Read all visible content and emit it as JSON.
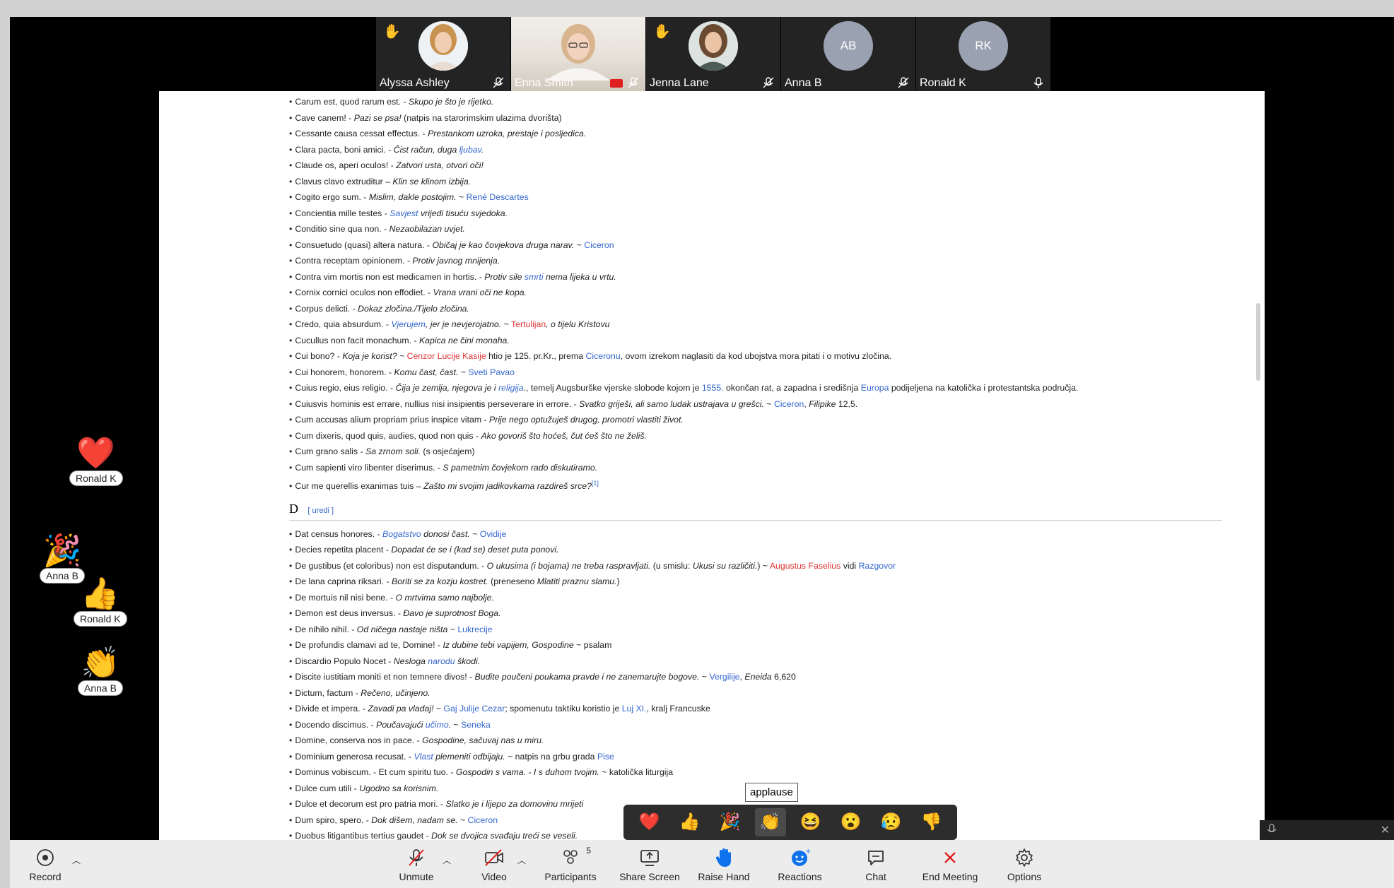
{
  "participants": [
    {
      "name": "Alyssa Ashley",
      "hand": true,
      "type": "photo",
      "muted": true
    },
    {
      "name": "Enna Smith",
      "hand": false,
      "type": "video",
      "muted": true,
      "camera_off": true
    },
    {
      "name": "Jenna Lane",
      "hand": true,
      "type": "photo",
      "muted": true
    },
    {
      "name": "Anna B",
      "hand": false,
      "type": "initials",
      "initials": "AB",
      "muted": true
    },
    {
      "name": "Ronald K",
      "hand": false,
      "type": "initials",
      "initials": "RK",
      "muted": false
    }
  ],
  "doc_items_c": [
    [
      [
        "Carum est, quod rarum est. - ",
        ""
      ],
      [
        "Skupo je što je rijetko.",
        "it"
      ]
    ],
    [
      [
        "Cave canem! - ",
        ""
      ],
      [
        "Pazi se psa!",
        "it"
      ],
      [
        " (natpis na starorimskim ulazima dvorišta)",
        ""
      ]
    ],
    [
      [
        "Cessante causa cessat effectus. - ",
        ""
      ],
      [
        "Prestankom uzroka, prestaje i posljedica.",
        "it"
      ]
    ],
    [
      [
        "Clara pacta, boni amici. - ",
        ""
      ],
      [
        "Čist račun, duga ",
        "it"
      ],
      [
        "ljubav",
        "it lk"
      ],
      [
        ".",
        "it"
      ]
    ],
    [
      [
        "Claude os, aperi oculos! - ",
        ""
      ],
      [
        "Zatvori usta, otvori oči!",
        "it"
      ]
    ],
    [
      [
        "Clavus clavo extruditur – ",
        ""
      ],
      [
        "Klin se klinom izbija.",
        "it"
      ]
    ],
    [
      [
        "Cogito ergo sum. - ",
        ""
      ],
      [
        "Mislim, dakle postojim.",
        "it"
      ],
      [
        " ~ ",
        ""
      ],
      [
        "René Descartes",
        "lk"
      ]
    ],
    [
      [
        "Concientia mille testes - ",
        ""
      ],
      [
        "Savjest",
        "it lk"
      ],
      [
        " vrijedi tisuću svjedoka.",
        "it"
      ]
    ],
    [
      [
        "Conditio sine qua non. - ",
        ""
      ],
      [
        "Nezaobilazan uvjet.",
        "it"
      ]
    ],
    [
      [
        "Consuetudo (quasi) altera natura. - ",
        ""
      ],
      [
        "Običaj je kao čovjekova druga narav.",
        "it"
      ],
      [
        " ~ ",
        ""
      ],
      [
        "Ciceron",
        "lk"
      ]
    ],
    [
      [
        "Contra receptam opinionem. - ",
        ""
      ],
      [
        "Protiv javnog mnijenja.",
        "it"
      ]
    ],
    [
      [
        "Contra vim mortis non est medicamen in hortis. - ",
        ""
      ],
      [
        "Protiv sile ",
        "it"
      ],
      [
        "smrti",
        "it lk"
      ],
      [
        " nema lijeka u vrtu.",
        "it"
      ]
    ],
    [
      [
        "Cornix cornici oculos non effodiet. - ",
        ""
      ],
      [
        "Vrana vrani oči ne kopa.",
        "it"
      ]
    ],
    [
      [
        "Corpus delicti. - ",
        ""
      ],
      [
        "Dokaz zločina./Tijelo zločina.",
        "it"
      ]
    ],
    [
      [
        "Credo, quia absurdum. - ",
        ""
      ],
      [
        "Vjerujem",
        "it lk"
      ],
      [
        ", jer je nevjerojatno.",
        "it"
      ],
      [
        " ~ ",
        ""
      ],
      [
        "Tertulijan",
        "rd"
      ],
      [
        ", o tijelu Kristovu",
        "it"
      ]
    ],
    [
      [
        "Cucullus non facit monachum. - ",
        ""
      ],
      [
        "Kapica ne čini monaha.",
        "it"
      ]
    ],
    [
      [
        "Cui bono? - ",
        ""
      ],
      [
        "Koja je korist?",
        "it"
      ],
      [
        " ~ ",
        ""
      ],
      [
        "Cenzor Lucije Kasije",
        "rd"
      ],
      [
        " htio je 125. pr.Kr., prema ",
        ""
      ],
      [
        "Ciceronu",
        "lk"
      ],
      [
        ", ovom izrekom naglasiti da kod ubojstva mora pitati i o motivu zločina.",
        ""
      ]
    ],
    [
      [
        "Cui honorem, honorem. - ",
        ""
      ],
      [
        "Komu čast, čast.",
        "it"
      ],
      [
        " ~ ",
        ""
      ],
      [
        "Sveti Pavao",
        "lk"
      ]
    ],
    [
      [
        "Cuius regio, eius religio. - ",
        ""
      ],
      [
        "Čija je zemlja, njegova je i ",
        "it"
      ],
      [
        "religija",
        "it lk"
      ],
      [
        ".",
        ""
      ],
      [
        ", temelj Augsburške vjerske slobode kojom je ",
        ""
      ],
      [
        "1555.",
        "lk"
      ],
      [
        " okončan rat, a zapadna i središnja ",
        ""
      ],
      [
        "Europa",
        "lk"
      ],
      [
        " podijeljena na katolička i protestantska područja.",
        ""
      ]
    ],
    [
      [
        "Cuiusvis hominis est errare, nullius nisi insipientis perseverare in errore. - ",
        ""
      ],
      [
        "Svatko griješi, ali samo ludak ustrajava u grešci.",
        "it"
      ],
      [
        " ~ ",
        ""
      ],
      [
        "Ciceron",
        "lk"
      ],
      [
        ", ",
        ""
      ],
      [
        "Filipike",
        "it"
      ],
      [
        " 12,5.",
        ""
      ]
    ],
    [
      [
        "Cum accusas alium propriam prius inspice vitam - ",
        ""
      ],
      [
        "Prije nego optužuješ drugog, promotri vlastiti život.",
        "it"
      ]
    ],
    [
      [
        "Cum dixeris, quod quis, audies, quod non quis - ",
        ""
      ],
      [
        "Ako govoriš što hoćeš, čut ćeš što ne želiš.",
        "it"
      ]
    ],
    [
      [
        "Cum grano salis - ",
        ""
      ],
      [
        "Sa zrnom soli.",
        "it"
      ],
      [
        " (s osjećajem)",
        ""
      ]
    ],
    [
      [
        "Cum sapienti viro libenter diserimus. - ",
        ""
      ],
      [
        "S pametnim čovjekom rado diskutiramo.",
        "it"
      ]
    ],
    [
      [
        "Cur me querellis exanimas tuis – ",
        ""
      ],
      [
        "Zašto mi svojim jadikovkama razdireš srce?",
        "it"
      ],
      [
        "[1]",
        "lk sup"
      ]
    ]
  ],
  "section_d": {
    "letter": "D",
    "edit": "[ uredi ]"
  },
  "doc_items_d": [
    [
      [
        "Dat census honores. - ",
        ""
      ],
      [
        "Bogatstvo",
        "it lk"
      ],
      [
        " donosi čast.",
        "it"
      ],
      [
        " ~ ",
        ""
      ],
      [
        "Ovidije",
        "lk"
      ]
    ],
    [
      [
        "Decies repetita placent - ",
        ""
      ],
      [
        "Dopadat će se i (kad se) deset puta ponovi.",
        "it"
      ]
    ],
    [
      [
        "De gustibus (et coloribus) non est disputandum. - ",
        ""
      ],
      [
        "O ukusima (i bojama) ne treba raspravljati.",
        "it"
      ],
      [
        " (u smislu: ",
        ""
      ],
      [
        "Ukusi su različiti.",
        "it"
      ],
      [
        ") ~ ",
        ""
      ],
      [
        "Augustus Faselius",
        "rd"
      ],
      [
        " vidi ",
        ""
      ],
      [
        "Razgovor",
        "lk"
      ]
    ],
    [
      [
        "De lana caprina riksari. - ",
        ""
      ],
      [
        "Boriti se za kozju kostret.",
        "it"
      ],
      [
        " (preneseno ",
        ""
      ],
      [
        "Mlatiti praznu slamu.",
        "it"
      ],
      [
        ")",
        ""
      ]
    ],
    [
      [
        "De mortuis nil nisi bene. - ",
        ""
      ],
      [
        "O mrtvima samo najbolje.",
        "it"
      ]
    ],
    [
      [
        "Demon est deus inversus. - ",
        ""
      ],
      [
        "Đavo je suprotnost Boga.",
        "it"
      ]
    ],
    [
      [
        "De nihilo nihil. - ",
        ""
      ],
      [
        "Od ničega nastaje ništa",
        "it"
      ],
      [
        " ~ ",
        ""
      ],
      [
        "Lukrecije",
        "lk"
      ]
    ],
    [
      [
        "De profundis clamavi ad te, Domine! - ",
        ""
      ],
      [
        "Iz dubine tebi vapijem, Gospodine",
        "it"
      ],
      [
        " ~ psalam",
        ""
      ]
    ],
    [
      [
        "Discardio Populo Nocet - ",
        ""
      ],
      [
        "Nesloga ",
        "it"
      ],
      [
        "narodu",
        "it lk"
      ],
      [
        " škodi.",
        "it"
      ]
    ],
    [
      [
        "Discite iustitiam moniti et non temnere divos! - ",
        ""
      ],
      [
        "Budite poučeni poukama pravde i ne zanemarujte bogove.",
        "it"
      ],
      [
        " ~ ",
        ""
      ],
      [
        "Vergilije",
        "lk"
      ],
      [
        ", ",
        ""
      ],
      [
        "Eneida",
        "it"
      ],
      [
        " 6,620",
        ""
      ]
    ],
    [
      [
        "Dictum, factum - ",
        ""
      ],
      [
        "Rečeno, učinjeno.",
        "it"
      ]
    ],
    [
      [
        "Divide et impera. - ",
        ""
      ],
      [
        "Zavadi pa vladaj!",
        "it"
      ],
      [
        " ~ ",
        ""
      ],
      [
        "Gaj Julije Cezar",
        "lk"
      ],
      [
        "; spomenutu taktiku koristio je ",
        ""
      ],
      [
        "Luj XI.",
        "lk"
      ],
      [
        ", kralj Francuske",
        ""
      ]
    ],
    [
      [
        "Docendo discimus. - ",
        ""
      ],
      [
        "Poučavajući ",
        "it"
      ],
      [
        "učimo",
        "it lk"
      ],
      [
        ".",
        "it"
      ],
      [
        " ~ ",
        ""
      ],
      [
        "Seneka",
        "lk"
      ]
    ],
    [
      [
        "Domine, conserva nos in pace. - ",
        ""
      ],
      [
        "Gospodine, sačuvaj nas u miru.",
        "it"
      ]
    ],
    [
      [
        "Dominium generosa recusat. - ",
        ""
      ],
      [
        "Vlast",
        "it lk"
      ],
      [
        " plemeniti odbijaju.",
        "it"
      ],
      [
        " ~ natpis na grbu grada ",
        ""
      ],
      [
        "Pise",
        "lk"
      ]
    ],
    [
      [
        "Dominus vobiscum. - Et cum spiritu tuo. - ",
        ""
      ],
      [
        "Gospodin s vama. - I s duhom tvojim.",
        "it"
      ],
      [
        " ~ katolička liturgija",
        ""
      ]
    ],
    [
      [
        "Dulce cum utili - ",
        ""
      ],
      [
        "Ugodno sa korisnim.",
        "it"
      ]
    ],
    [
      [
        "Dulce et decorum est pro patria mori. - ",
        ""
      ],
      [
        "Slatko je i lijepo za domovinu mrijeti",
        "it"
      ]
    ],
    [
      [
        "Dum spiro, spero. - ",
        ""
      ],
      [
        "Dok dišem, nadam se.",
        "it"
      ],
      [
        " ~ ",
        ""
      ],
      [
        "Ciceron",
        "lk"
      ]
    ],
    [
      [
        "Duobus litigantibus tertius gaudet - ",
        ""
      ],
      [
        "Dok se dvojica svađaju treći se veseli.",
        "it"
      ]
    ]
  ],
  "side_reactions": [
    {
      "emoji": "❤️",
      "name": "Ronald K"
    },
    {
      "emoji": "🎉",
      "name": "Anna B"
    },
    {
      "emoji": "👍",
      "name": "Ronald K"
    },
    {
      "emoji": "👏",
      "name": "Anna B"
    }
  ],
  "reaction_tooltip": "applause",
  "reaction_bar": [
    "❤️",
    "👍",
    "🎉",
    "👏",
    "😆",
    "😮",
    "😥",
    "👎"
  ],
  "toolbar": {
    "record": "Record",
    "unmute": "Unmute",
    "video": "Video",
    "participants": "Participants",
    "participants_count": "5",
    "share": "Share Screen",
    "raise_hand": "Raise Hand",
    "reactions": "Reactions",
    "chat": "Chat",
    "end": "End Meeting",
    "options": "Options"
  },
  "colors": {
    "accent": "#0e72ed",
    "end": "#e02020",
    "link": "#3366cc",
    "redlink": "#dd3333"
  }
}
